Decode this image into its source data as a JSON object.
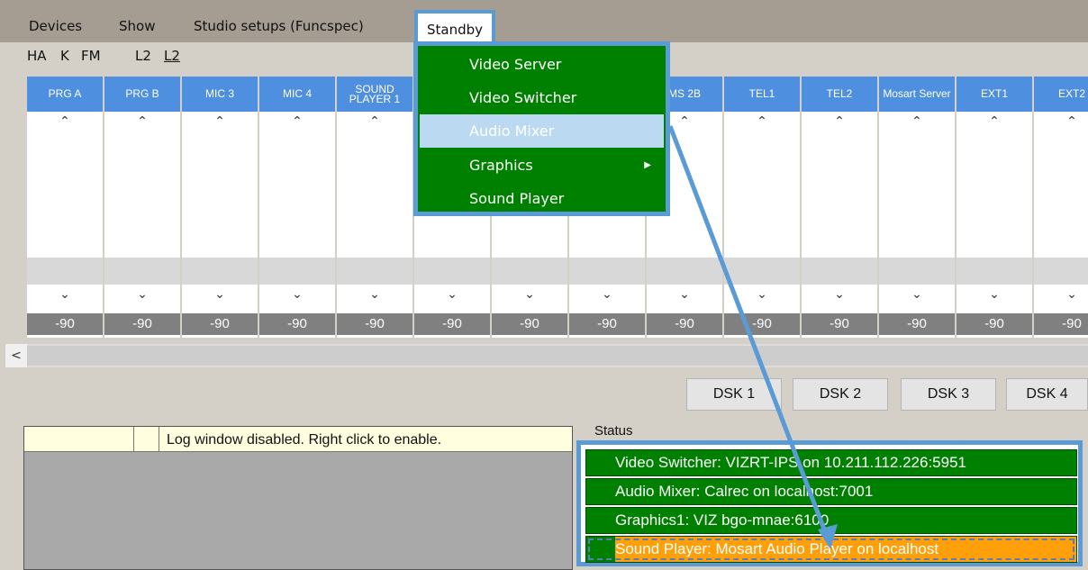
{
  "menubar": {
    "items": [
      "Devices",
      "Show",
      "Studio setups (Funcspec)",
      "Standby"
    ]
  },
  "shortcuts": [
    "HA",
    "K",
    "FM",
    "L2",
    "L2"
  ],
  "channels": [
    {
      "name": "PRG A",
      "value": "-90"
    },
    {
      "name": "PRG B",
      "value": "-90"
    },
    {
      "name": "MIC 3",
      "value": "-90"
    },
    {
      "name": "MIC 4",
      "value": "-90"
    },
    {
      "name": "SOUND PLAYER 1",
      "value": "-90"
    },
    {
      "name": "",
      "value": "-90"
    },
    {
      "name": "",
      "value": "-90"
    },
    {
      "name": "",
      "value": "-90"
    },
    {
      "name": "MS 2B",
      "value": "-90"
    },
    {
      "name": "TEL1",
      "value": "-90"
    },
    {
      "name": "TEL2",
      "value": "-90"
    },
    {
      "name": "Mosart Server",
      "value": "-90"
    },
    {
      "name": "EXT1",
      "value": "-90"
    },
    {
      "name": "EXT2",
      "value": "-90"
    }
  ],
  "dsk_buttons": [
    "DSK 1",
    "DSK 2",
    "DSK 3",
    "DSK 4"
  ],
  "log": {
    "message": "Log window disabled. Right click to enable."
  },
  "status": {
    "title": "Status",
    "rows": [
      {
        "text": "Video Switcher: VIZRT-IPS on 10.211.112.226:5951",
        "state": "ok"
      },
      {
        "text": "Audio Mixer: Calrec on localhost:7001",
        "state": "ok"
      },
      {
        "text": "Graphics1: VIZ bgo-mnae:6100",
        "state": "ok"
      },
      {
        "text": "Sound Player: Mosart Audio Player on localhost",
        "state": "warning"
      }
    ]
  },
  "standby_menu": {
    "items": [
      {
        "label": "Video Server",
        "highlighted": false,
        "submenu": false
      },
      {
        "label": "Video Switcher",
        "highlighted": false,
        "submenu": false
      },
      {
        "label": "Audio Mixer",
        "highlighted": true,
        "submenu": false
      },
      {
        "label": "Graphics",
        "highlighted": false,
        "submenu": true
      },
      {
        "label": "Sound Player",
        "highlighted": false,
        "submenu": false
      }
    ]
  },
  "colors": {
    "ok": "#008000",
    "warning": "#ff9f0a",
    "header": "#4f8fdf",
    "accent": "#5b9bd5"
  },
  "icons": {
    "up": "chevron-up-icon",
    "down": "chevron-down-icon",
    "scroll_left": "chevron-left-icon",
    "submenu": "triangle-right-icon"
  }
}
